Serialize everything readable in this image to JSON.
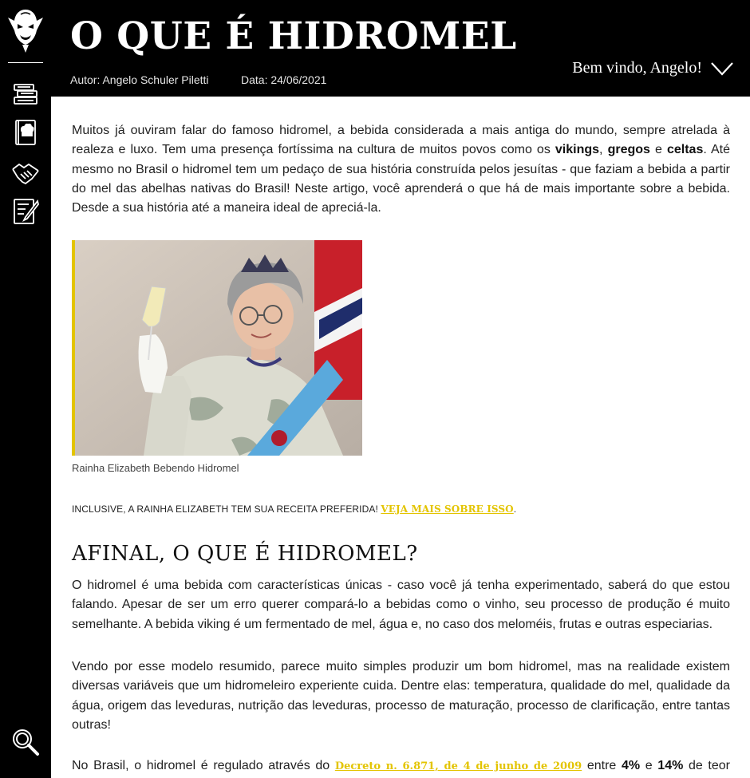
{
  "header": {
    "title": "O QUE É HIDROMEL",
    "author": "Autor: Angelo Schuler Piletti",
    "date": "Data: 24/06/2021",
    "welcome": "Bem vindo, Angelo!"
  },
  "sidebar": {
    "items": [
      {
        "name": "books",
        "icon": "books-stack-icon"
      },
      {
        "name": "recipes",
        "icon": "chef-book-icon"
      },
      {
        "name": "partners",
        "icon": "handshake-icon"
      },
      {
        "name": "notes",
        "icon": "notepad-quill-icon"
      }
    ],
    "search_icon": "magnifier-icon"
  },
  "article": {
    "intro": {
      "p1": "Muitos já ouviram falar do famoso hidromel, a bebida considerada a mais antiga do mundo, sempre atrelada à realeza e luxo. Tem uma presença fortíssima na cultura de muitos povos como os ",
      "b1": "vikings",
      "sep1": ", ",
      "b2": "gregos",
      "sep2": " e ",
      "b3": "celtas",
      "p2": ". Até mesmo no Brasil o hidromel tem um pedaço de sua história construída pelos jesuítas - que faziam a bebida a partir do mel das abelhas nativas do Brasil! Neste artigo, você aprenderá o que há de mais importante sobre a bebida. Desde a sua história até a maneira ideal de apreciá-la."
    },
    "image_caption": "Rainha Elizabeth Bebendo Hidromel",
    "inclusive_text": "INCLUSIVE, A RAINHA ELIZABETH TEM SUA RECEITA PREFERIDA! ",
    "inclusive_link": "VEJA MAIS SOBRE ISSO",
    "inclusive_end": ".",
    "section_title": "AFINAL, O QUE É HIDROMEL?",
    "para1": "O hidromel é uma bebida com características únicas - caso você já tenha experimentado, saberá do que estou falando. Apesar de ser um erro querer compará-lo a bebidas como o vinho, seu processo de produção é muito semelhante. A bebida viking é um fermentado de mel, água e, no caso dos meloméis, frutas e outras especiarias.",
    "para2": "Vendo por esse modelo resumido, parece muito simples produzir um bom hidromel, mas na realidade existem diversas variáveis que um hidromeleiro experiente cuida. Dentre elas: temperatura, qualidade do mel, qualidade da água, origem das leveduras, nutrição das leveduras, processo de maturação, processo de clarificação, entre tantas outras!",
    "para3": {
      "pre": "No Brasil, o hidromel é regulado através do ",
      "link": "Decreto n. 6.871, de 4 de junho de 2009",
      "mid1": " entre ",
      "b1": "4%",
      "mid2": " e ",
      "b2": "14%",
      "post": " de teor alcoólico."
    }
  },
  "colors": {
    "accent": "#e3c400",
    "background": "#000000",
    "content_bg": "#ffffff"
  }
}
